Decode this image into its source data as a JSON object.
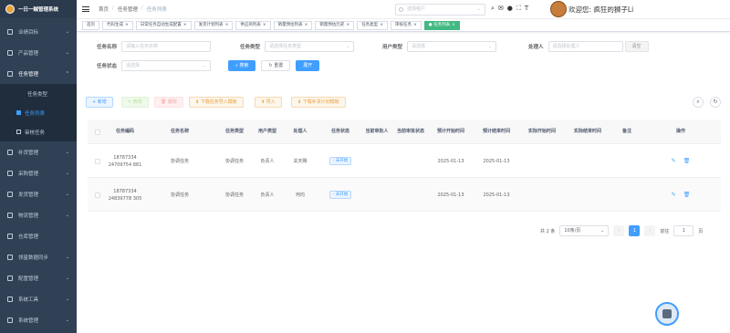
{
  "app": {
    "title": "一日一贼管理系统"
  },
  "sidebar": {
    "items": [
      {
        "label": "业绩目标",
        "arrow": "⌄"
      },
      {
        "label": "产品管理",
        "arrow": "⌄"
      },
      {
        "label": "任务管理",
        "arrow": "⌃"
      }
    ],
    "subitems": [
      "任务类型",
      "任务列表",
      "审核任务"
    ],
    "items2": [
      {
        "label": "补货管理",
        "arrow": "⌄"
      },
      {
        "label": "采购管理",
        "arrow": "⌄"
      },
      {
        "label": "发货管理",
        "arrow": "⌄"
      },
      {
        "label": "物流管理",
        "arrow": "⌄"
      },
      {
        "label": "仓库管理",
        "arrow": ""
      },
      {
        "label": "领星数据同步",
        "arrow": "⌄"
      },
      {
        "label": "配置管理",
        "arrow": "⌄"
      },
      {
        "label": "系统工具",
        "arrow": "⌄"
      },
      {
        "label": "系统管理",
        "arrow": "⌄"
      }
    ]
  },
  "header": {
    "breadcrumb": [
      "首页",
      "任务管理",
      "任务列表"
    ],
    "tenant_placeholder": "选择租户",
    "welcome": "欢迎您: 疯狂的狮子Li"
  },
  "tags": [
    "首页",
    "代码生成",
    "日常任务自动生成配置",
    "发货计划列表",
    "供应商列表",
    "销量预估列表",
    "销量预估历史",
    "任务类型",
    "审核任务",
    "任务列表"
  ],
  "search": {
    "name_label": "任务名称",
    "name_placeholder": "请输入任务名称",
    "type_label": "任务类型",
    "type_placeholder": "请选择任务类型",
    "user_type_label": "用户类型",
    "user_type_placeholder": "请选择",
    "handler_label": "处理人",
    "handler_placeholder": "请选择处理人",
    "clear": "清空",
    "status_label": "任务状态",
    "status_placeholder": "请选择",
    "search_btn": "搜索",
    "reset_btn": "重置",
    "expand_btn": "展开"
  },
  "toolbar": {
    "add": "新增",
    "edit": "修改",
    "delete": "删除",
    "download_import_tpl": "下载任务导入模板",
    "import": "导入",
    "download_plan_tpl": "下载补货计划模板"
  },
  "table": {
    "headers": [
      "任务编码",
      "任务名称",
      "任务类型",
      "用户类型",
      "处理人",
      "任务状态",
      "当前审批人",
      "当前审批状态",
      "预计开始时间",
      "预计结束时间",
      "实际开始时间",
      "实际结束时间",
      "备注",
      "操作"
    ],
    "rows": [
      {
        "code": "18787334 24709754 881",
        "name": "协调任务",
        "type": "协调任务",
        "user_type": "负责人",
        "handler": "关天赐",
        "status": "未开始",
        "approver": "",
        "approval_status": "",
        "plan_start": "2025-01-13",
        "plan_end": "2025-01-13",
        "actual_start": "",
        "actual_end": "",
        "remark": ""
      },
      {
        "code": "18787334 24839778 305",
        "name": "协调任务",
        "type": "协调任务",
        "user_type": "负责人",
        "handler": "何均",
        "status": "未开始",
        "approver": "",
        "approval_status": "",
        "plan_start": "2025-01-13",
        "plan_end": "2025-01-13",
        "actual_start": "",
        "actual_end": "",
        "remark": ""
      }
    ]
  },
  "pagination": {
    "total": "共 2 条",
    "page_size": "10条/页",
    "current": "1",
    "goto_label": "前往",
    "goto_value": "1",
    "page_suffix": "页"
  },
  "icons": {
    "search": "search-icon",
    "message": "message-icon",
    "github": "github-icon",
    "fullscreen": "fullscreen-icon",
    "size": "font-size-icon"
  },
  "colors": {
    "primary": "#409eff",
    "sidebar": "#304156",
    "active_tag": "#42b983"
  }
}
